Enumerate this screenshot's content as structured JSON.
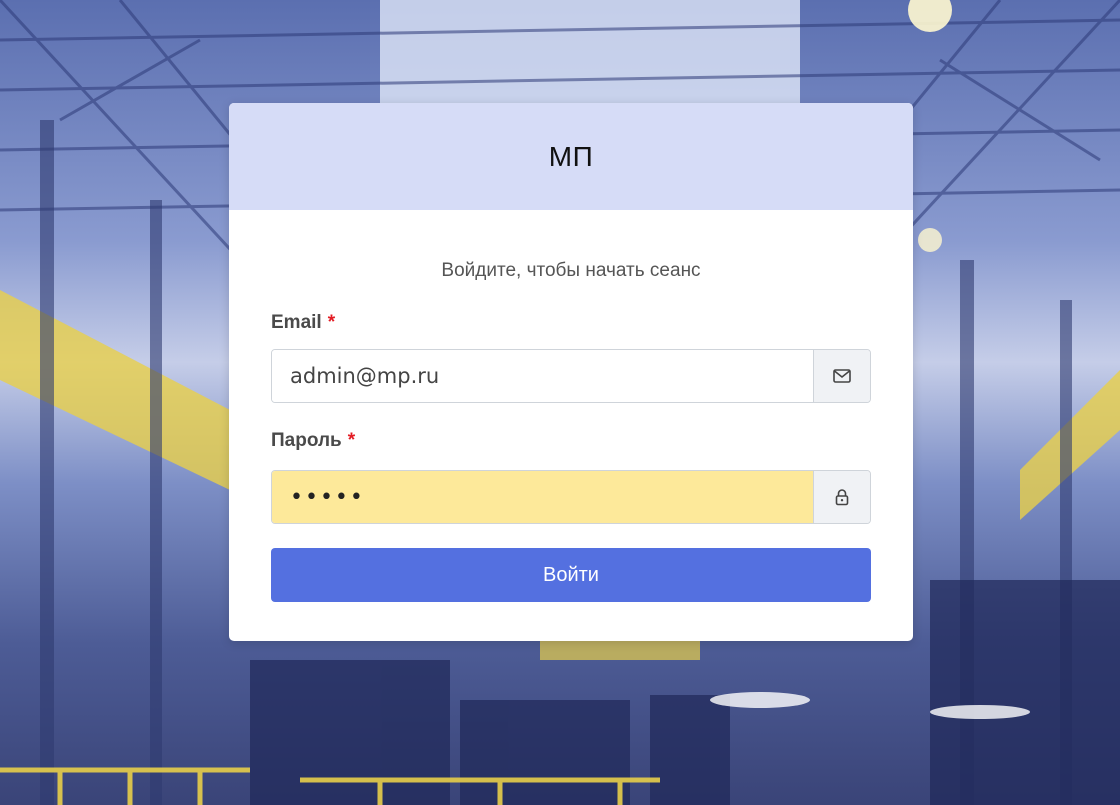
{
  "card": {
    "title": "МП",
    "subtitle": "Войдите, чтобы начать сеанс"
  },
  "form": {
    "email": {
      "label": "Email",
      "required_marker": "*",
      "value": "admin@mp.ru",
      "icon": "envelope-icon"
    },
    "password": {
      "label": "Пароль",
      "required_marker": "*",
      "value": "•••••",
      "icon": "lock-icon",
      "autofill_color": "#fde99a"
    },
    "submit_label": "Войти"
  },
  "colors": {
    "header_bg": "#d6dcf7",
    "accent": "#5470e0",
    "required": "#e31b23"
  }
}
